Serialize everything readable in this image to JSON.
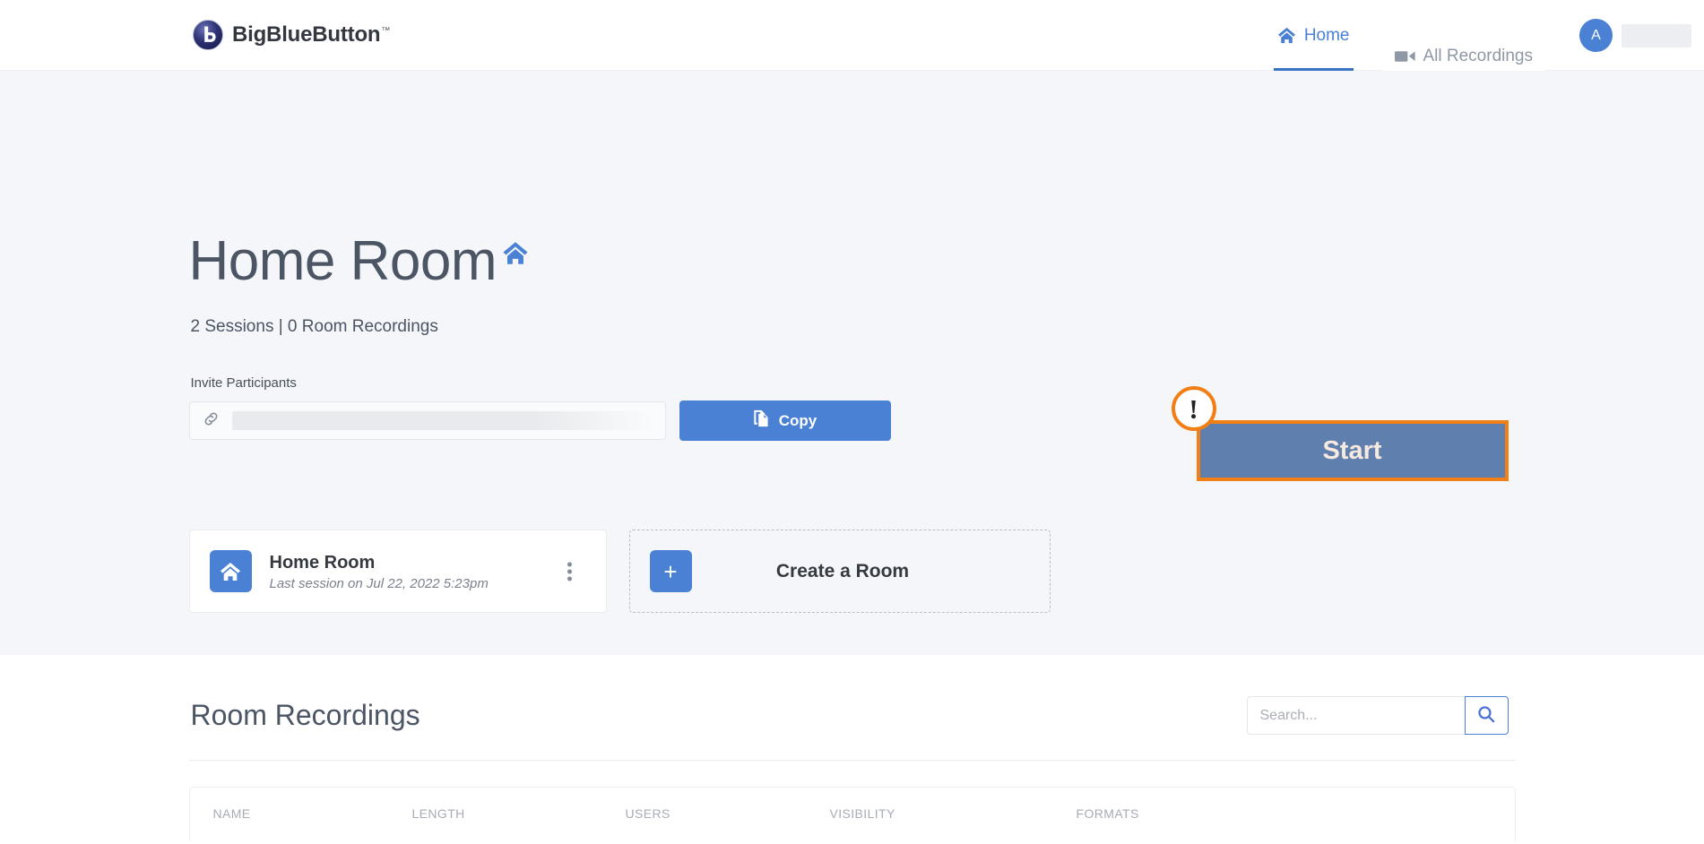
{
  "header": {
    "brand_name": "BigBlueButton",
    "brand_tm": "™",
    "nav": [
      {
        "label": "Home",
        "icon": "home-icon",
        "active": true
      },
      {
        "label": "All Recordings",
        "icon": "video-camera-icon",
        "active": false
      }
    ],
    "avatar_initial": "A"
  },
  "hero": {
    "title": "Home Room",
    "title_icon": "home-icon",
    "subtitle": "2 Sessions | 0 Room Recordings",
    "invite_label": "Invite Participants",
    "invite_link_icon": "link-icon",
    "copy_button": "Copy",
    "copy_icon": "copy-icon",
    "start_button": "Start",
    "alert_badge": "!",
    "rooms": [
      {
        "name": "Home Room",
        "meta": "Last session on Jul 22, 2022 5:23pm",
        "icon": "home-icon",
        "menu_icon": "kebab-menu-icon"
      }
    ],
    "create_room": {
      "label": "Create a Room",
      "icon": "plus-icon"
    }
  },
  "recordings": {
    "title": "Room Recordings",
    "search_placeholder": "Search...",
    "search_value": "",
    "search_icon": "search-icon",
    "columns": [
      "NAME",
      "LENGTH",
      "USERS",
      "VISIBILITY",
      "FORMATS"
    ],
    "rows": []
  },
  "colors": {
    "primary_blue": "#4a81d4",
    "nav_blue": "#3a72c4",
    "hero_bg": "#f4f6fa",
    "start_fill": "#5f7fae",
    "annotation_orange": "#f07f16",
    "text_dark": "#343a40",
    "text_muted": "#7b828c"
  }
}
